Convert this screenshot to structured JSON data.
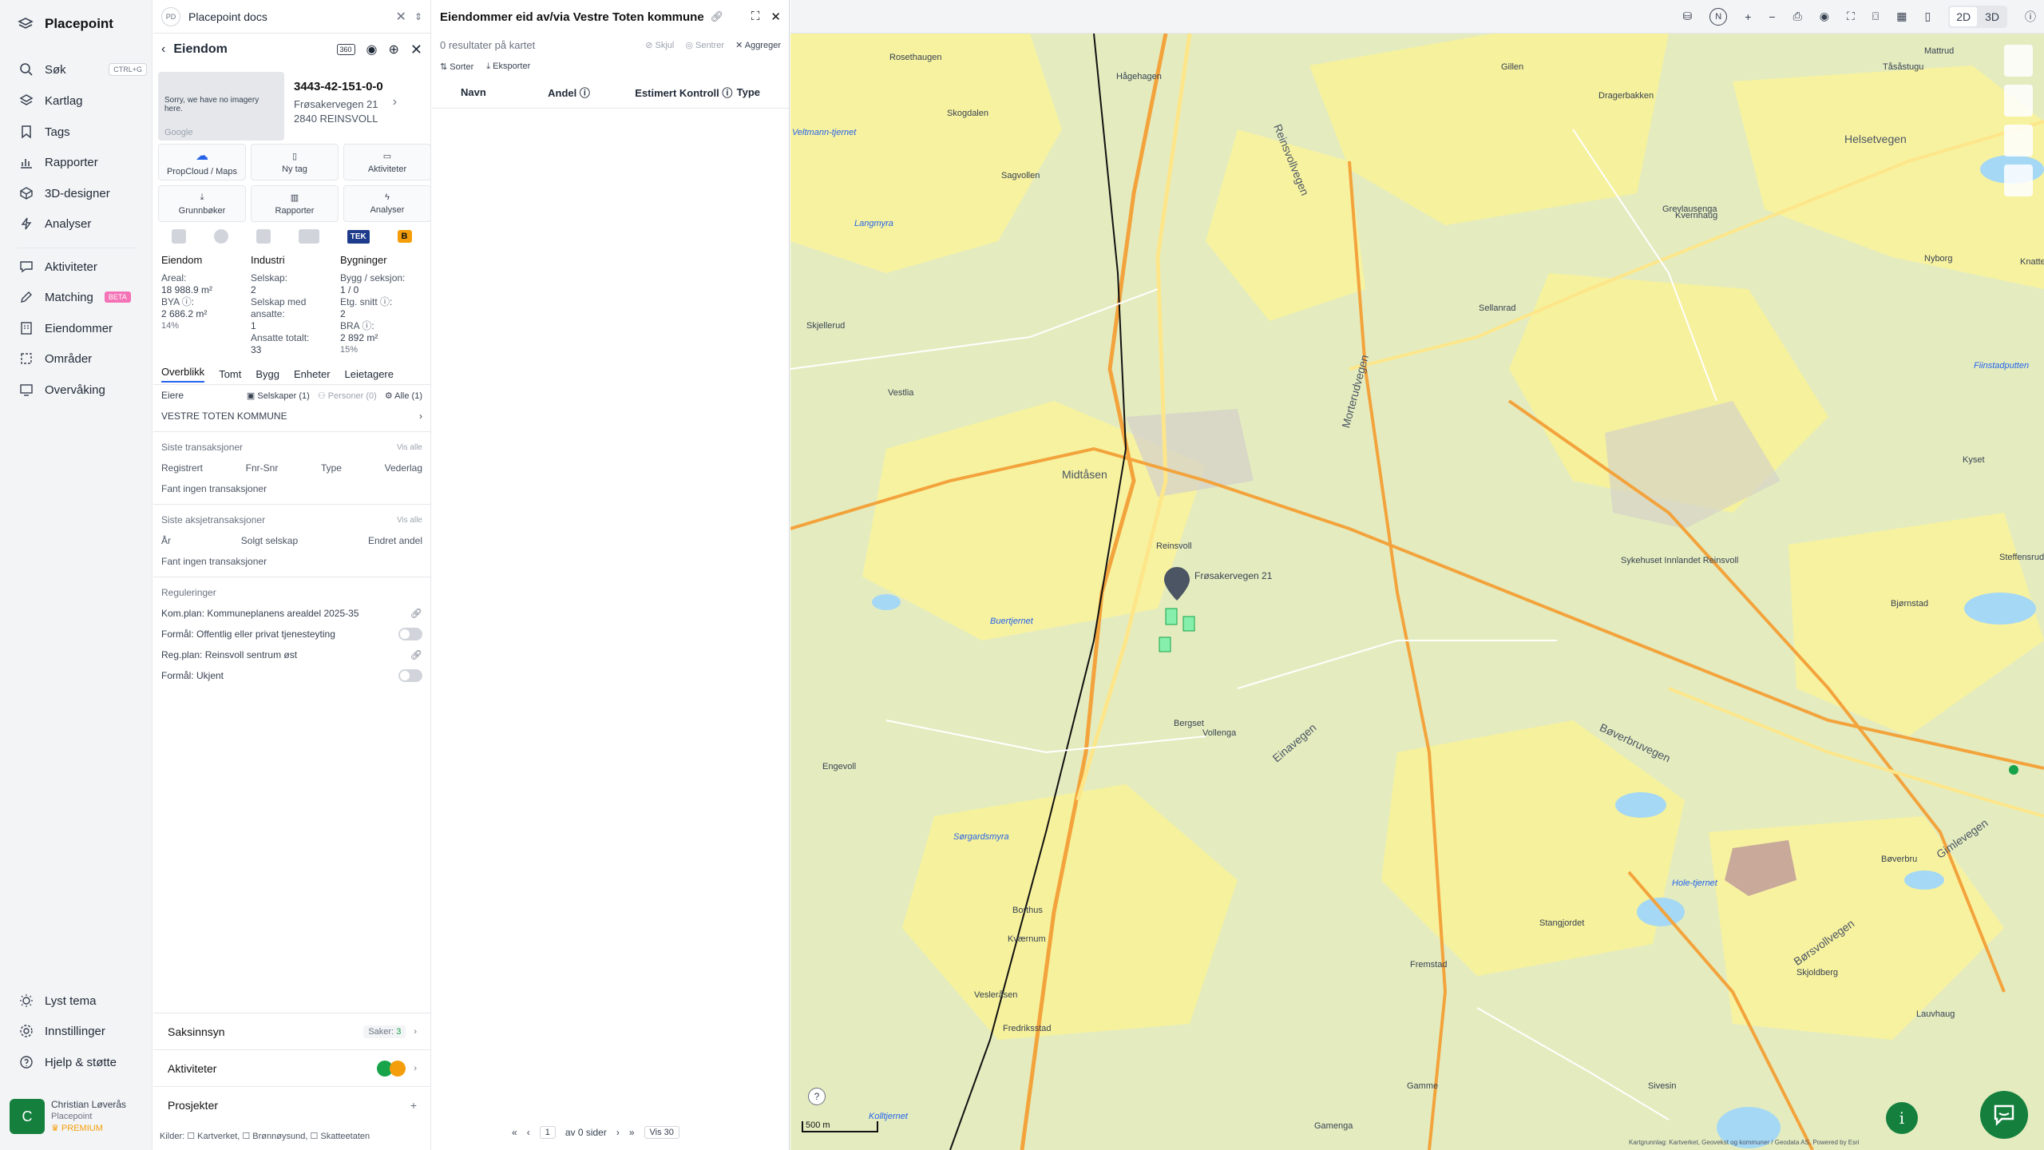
{
  "app": {
    "name": "Placepoint"
  },
  "nav": {
    "search": {
      "label": "Søk",
      "shortcut": "CTRL+G"
    },
    "items": [
      {
        "label": "Kartlag"
      },
      {
        "label": "Tags"
      },
      {
        "label": "Rapporter"
      },
      {
        "label": "3D-designer"
      },
      {
        "label": "Analyser"
      },
      {
        "label": "Aktiviteter"
      },
      {
        "label": "Matching",
        "badge": "BETA"
      },
      {
        "label": "Eiendommer"
      },
      {
        "label": "Områder"
      },
      {
        "label": "Overvåking"
      }
    ],
    "bottom": [
      {
        "label": "Lyst tema"
      },
      {
        "label": "Innstillinger"
      },
      {
        "label": "Hjelp & støtte"
      }
    ]
  },
  "user": {
    "initial": "C",
    "name": "Christian Løverås",
    "org": "Placepoint",
    "tier": "PREMIUM"
  },
  "docs_tab": {
    "badge": "PD",
    "label": "Placepoint docs"
  },
  "property": {
    "heading": "Eiendom",
    "id": "3443-42-151-0-0",
    "address1": "Frøsakervegen 21",
    "address2": "2840 REINSVOLL",
    "image_text": "Sorry, we have no imagery here.",
    "image_brand": "Google",
    "tiles": [
      "PropCloud / Maps",
      "Ny tag",
      "Aktiviteter",
      "Grunnbøker",
      "Rapporter",
      "Analyser"
    ],
    "tek_badge": "TEK",
    "b_badge": "B",
    "col1": {
      "title": "Eiendom",
      "areal_label": "Areal:",
      "areal": "18 988.9 m²",
      "bya_label": "BYA ⓘ:",
      "bya": "2 686.2 m²",
      "bya_pct": "14%"
    },
    "col2": {
      "title": "Industri",
      "selskap_label": "Selskap:",
      "selskap": "2",
      "ansatte_label": "Selskap med ansatte:",
      "ansatte": "1",
      "totalt_label": "Ansatte totalt:",
      "totalt": "33"
    },
    "col3": {
      "title": "Bygninger",
      "bygg_label": "Bygg / seksjon:",
      "bygg": "1 / 0",
      "etg_label": "Etg. snitt ⓘ:",
      "etg": "2",
      "bra_label": "BRA ⓘ:",
      "bra": "2 892 m²",
      "bra_pct": "15%"
    },
    "tabs": [
      "Overblikk",
      "Tomt",
      "Bygg",
      "Enheter",
      "Leietagere"
    ],
    "owners": {
      "label": "Eiere",
      "f1": "Selskaper (1)",
      "f2": "Personer (0)",
      "f3": "Alle (1)",
      "owner": "VESTRE TOTEN KOMMUNE"
    },
    "transactions": {
      "title": "Siste transaksjoner",
      "show_all": "Vis alle",
      "cols": [
        "Registrert",
        "Fnr-Snr",
        "Type",
        "Vederlag"
      ],
      "empty": "Fant ingen transaksjoner"
    },
    "share_tx": {
      "title": "Siste aksjetransaksjoner",
      "show_all": "Vis alle",
      "cols": [
        "År",
        "Solgt selskap",
        "Endret andel"
      ],
      "empty": "Fant ingen transaksjoner"
    },
    "regulations": {
      "title": "Reguleringer",
      "items": [
        "Kom.plan: Kommuneplanens arealdel 2025-35",
        "Formål: Offentlig eller privat tjenesteyting",
        "Reg.plan: Reinsvoll sentrum øst",
        "Formål: Ukjent"
      ]
    },
    "bottom": {
      "saksinnsyn": "Saksinnsyn",
      "saker_label": "Saker:",
      "saker": "3",
      "aktiviteter": "Aktiviteter",
      "prosjekter": "Prosjekter"
    },
    "sources": "Kilder: ☐ Kartverket, ☐ Brønnøysund, ☐ Skatteetaten"
  },
  "owned": {
    "title": "Eiendommer eid av/via Vestre Toten kommune",
    "results": "0 resultater på kartet",
    "hide": "Skjul",
    "center": "Sentrer",
    "aggregate": "Aggreger",
    "sort": "Sorter",
    "export": "Eksporter",
    "cols": [
      "Navn",
      "Andel ⓘ",
      "Estimert Kontroll ⓘ",
      "Type"
    ],
    "pager": {
      "page": "1",
      "of": "av 0 sider",
      "show": "Vis 30"
    }
  },
  "map": {
    "toolbar": {
      "n": "N",
      "plus": "+",
      "minus": "−",
      "2d": "2D",
      "3d": "3D"
    },
    "scale": "500 m",
    "attribution": "Kartgrunnlag: Kartverket, Geovekst og kommuner / Geodata AS, Powered by Esri",
    "marker_label": "Frøsakervegen 21",
    "labels": [
      "Rosethaugen",
      "Dragerbakken",
      "Tåsåstugu",
      "Helsetvegen",
      "Mattrud",
      "Skogdalen",
      "Reinsvoll",
      "Midtåsen",
      "Hågehagen",
      "Reinsvollvegen",
      "Morterudvegen",
      "Bøverbruvegen",
      "Gimlevegen",
      "Børsvollvegen",
      "Einavegen",
      "Langmyra",
      "Veltmann-tjernet",
      "Buertjernet",
      "Sagvollen",
      "Skjellerud",
      "Vestlia",
      "Engevoll",
      "Bjørnstad",
      "Sykehuset Innlandet Reinsvoll",
      "Bøverbru",
      "Steffensrud",
      "Fiinstadputten",
      "Nyborg",
      "Knattestad",
      "Sellanrad",
      "Grevlausenga",
      "Kvernhaug",
      "Sørgardsmyra",
      "Gamme",
      "Gamenga",
      "Kolltjernet",
      "Sivesin",
      "Hole-tjernet",
      "Stangjordet",
      "Fremstad",
      "Bergset",
      "Vollenga",
      "Kværnum",
      "Borthus",
      "Skjoldberg",
      "Fredriksstad",
      "Vesleråsen",
      "Kyset",
      "Lauvhaug",
      "Gillen"
    ]
  }
}
